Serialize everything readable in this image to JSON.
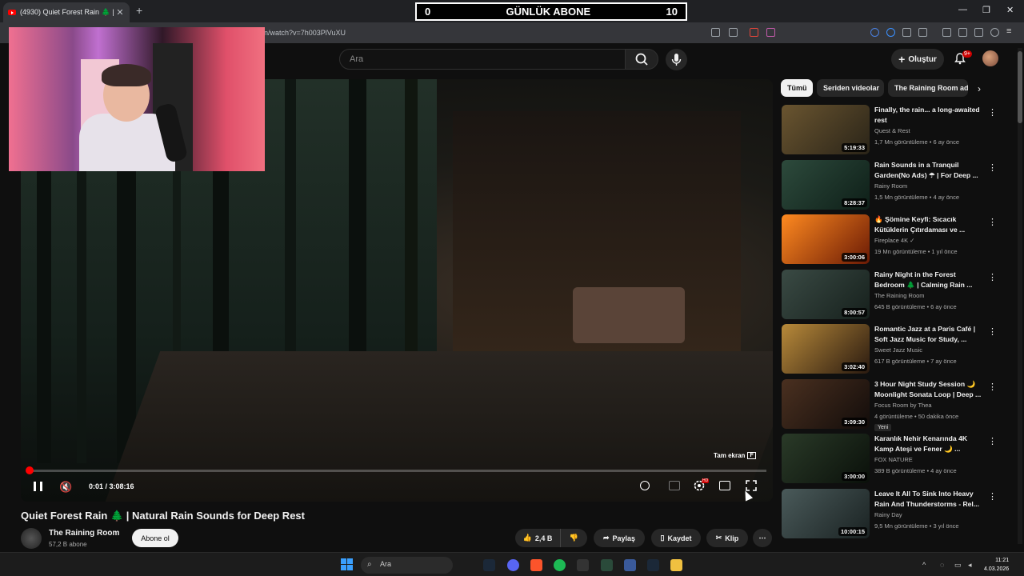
{
  "browser": {
    "tab_title": "(4930) Quiet Forest Rain 🌲 | Na",
    "url": "n/watch?v=7h003PlVuXU",
    "window_controls": [
      "—",
      "❐",
      "✕"
    ]
  },
  "overlay_counter": {
    "left": "0",
    "label": "GÜNLÜK ABONE",
    "right": "10"
  },
  "youtube_header": {
    "search_placeholder": "Ara",
    "create_label": "Oluştur",
    "notification_count": "9+"
  },
  "player": {
    "time": "0:01 / 3:08:16",
    "fullscreen_tip": "Tam ekran",
    "fullscreen_key": "F",
    "progress_fraction": 0.0001
  },
  "video": {
    "title": "Quiet Forest Rain 🌲 | Natural Rain Sounds for Deep Rest",
    "channel": "The Raining Room",
    "subscribers": "57,2 B abone",
    "subscribe_label": "Abone ol",
    "likes": "2,4 B",
    "share_label": "Paylaş",
    "save_label": "Kaydet",
    "clip_label": "Klip"
  },
  "chips": [
    "Tümü",
    "Seriden videolar",
    "The Raining Room ad"
  ],
  "recommendations": [
    {
      "title": "Finally, the rain... a long-awaited rest",
      "channel": "Quest & Rest",
      "meta": "1,7 Mn görüntüleme • 6 ay önce",
      "duration": "5:19:33",
      "colors": [
        "#6a5530",
        "#2a2418"
      ]
    },
    {
      "title": "Rain Sounds in a Tranquil Garden(No Ads) ☂ | For Deep ...",
      "channel": "Rainy Room",
      "meta": "1,5 Mn görüntüleme • 4 ay önce",
      "duration": "8:28:37",
      "colors": [
        "#2d4a3c",
        "#0e1f18"
      ]
    },
    {
      "title": "🔥 Şömine Keyfi: Sıcacık Kütüklerin Çıtırdaması ve ...",
      "channel": "Fireplace 4K ✓",
      "meta": "19 Mn görüntüleme • 1 yıl önce",
      "duration": "3:00:06",
      "colors": [
        "#ff8a20",
        "#6a1a05"
      ]
    },
    {
      "title": "Rainy Night in the Forest Bedroom 🌲 | Calming Rain ...",
      "channel": "The Raining Room",
      "meta": "645 B görüntüleme • 6 ay önce",
      "duration": "8:00:57",
      "colors": [
        "#3a4a44",
        "#16201c"
      ]
    },
    {
      "title": "Romantic Jazz at a Paris Café | Soft Jazz Music for Study, ...",
      "channel": "Sweet Jazz Music",
      "meta": "617 B görüntüleme • 7 ay önce",
      "duration": "3:02:40",
      "colors": [
        "#b88a3a",
        "#2a1a10"
      ]
    },
    {
      "title": "3 Hour Night Study Session 🌙 Moonlight Sonata Loop | Deep ...",
      "channel": "Focus Room by Thea",
      "meta": "4 görüntüleme • 50 dakika önce",
      "duration": "3:09:30",
      "badge": "Yeni",
      "colors": [
        "#4a3020",
        "#120c0a"
      ]
    },
    {
      "title": "Karanlık Nehir Kenarında 4K Kamp Ateşi ve Fener 🌙 ...",
      "channel": "FOX NATURE",
      "meta": "389 B görüntüleme • 4 ay önce",
      "duration": "3:00:00",
      "colors": [
        "#2a3a28",
        "#0a100a"
      ]
    },
    {
      "title": "Leave It All To Sink Into Heavy Rain And Thunderstorms - Rel...",
      "channel": "Rainy Day",
      "meta": "9,5 Mn görüntüleme • 3 yıl önce",
      "duration": "10:00:15",
      "colors": [
        "#4a5a5a",
        "#1a2222"
      ]
    }
  ],
  "taskbar": {
    "search_placeholder": "Ara",
    "time": "11:21",
    "date": "4.03.2026"
  }
}
